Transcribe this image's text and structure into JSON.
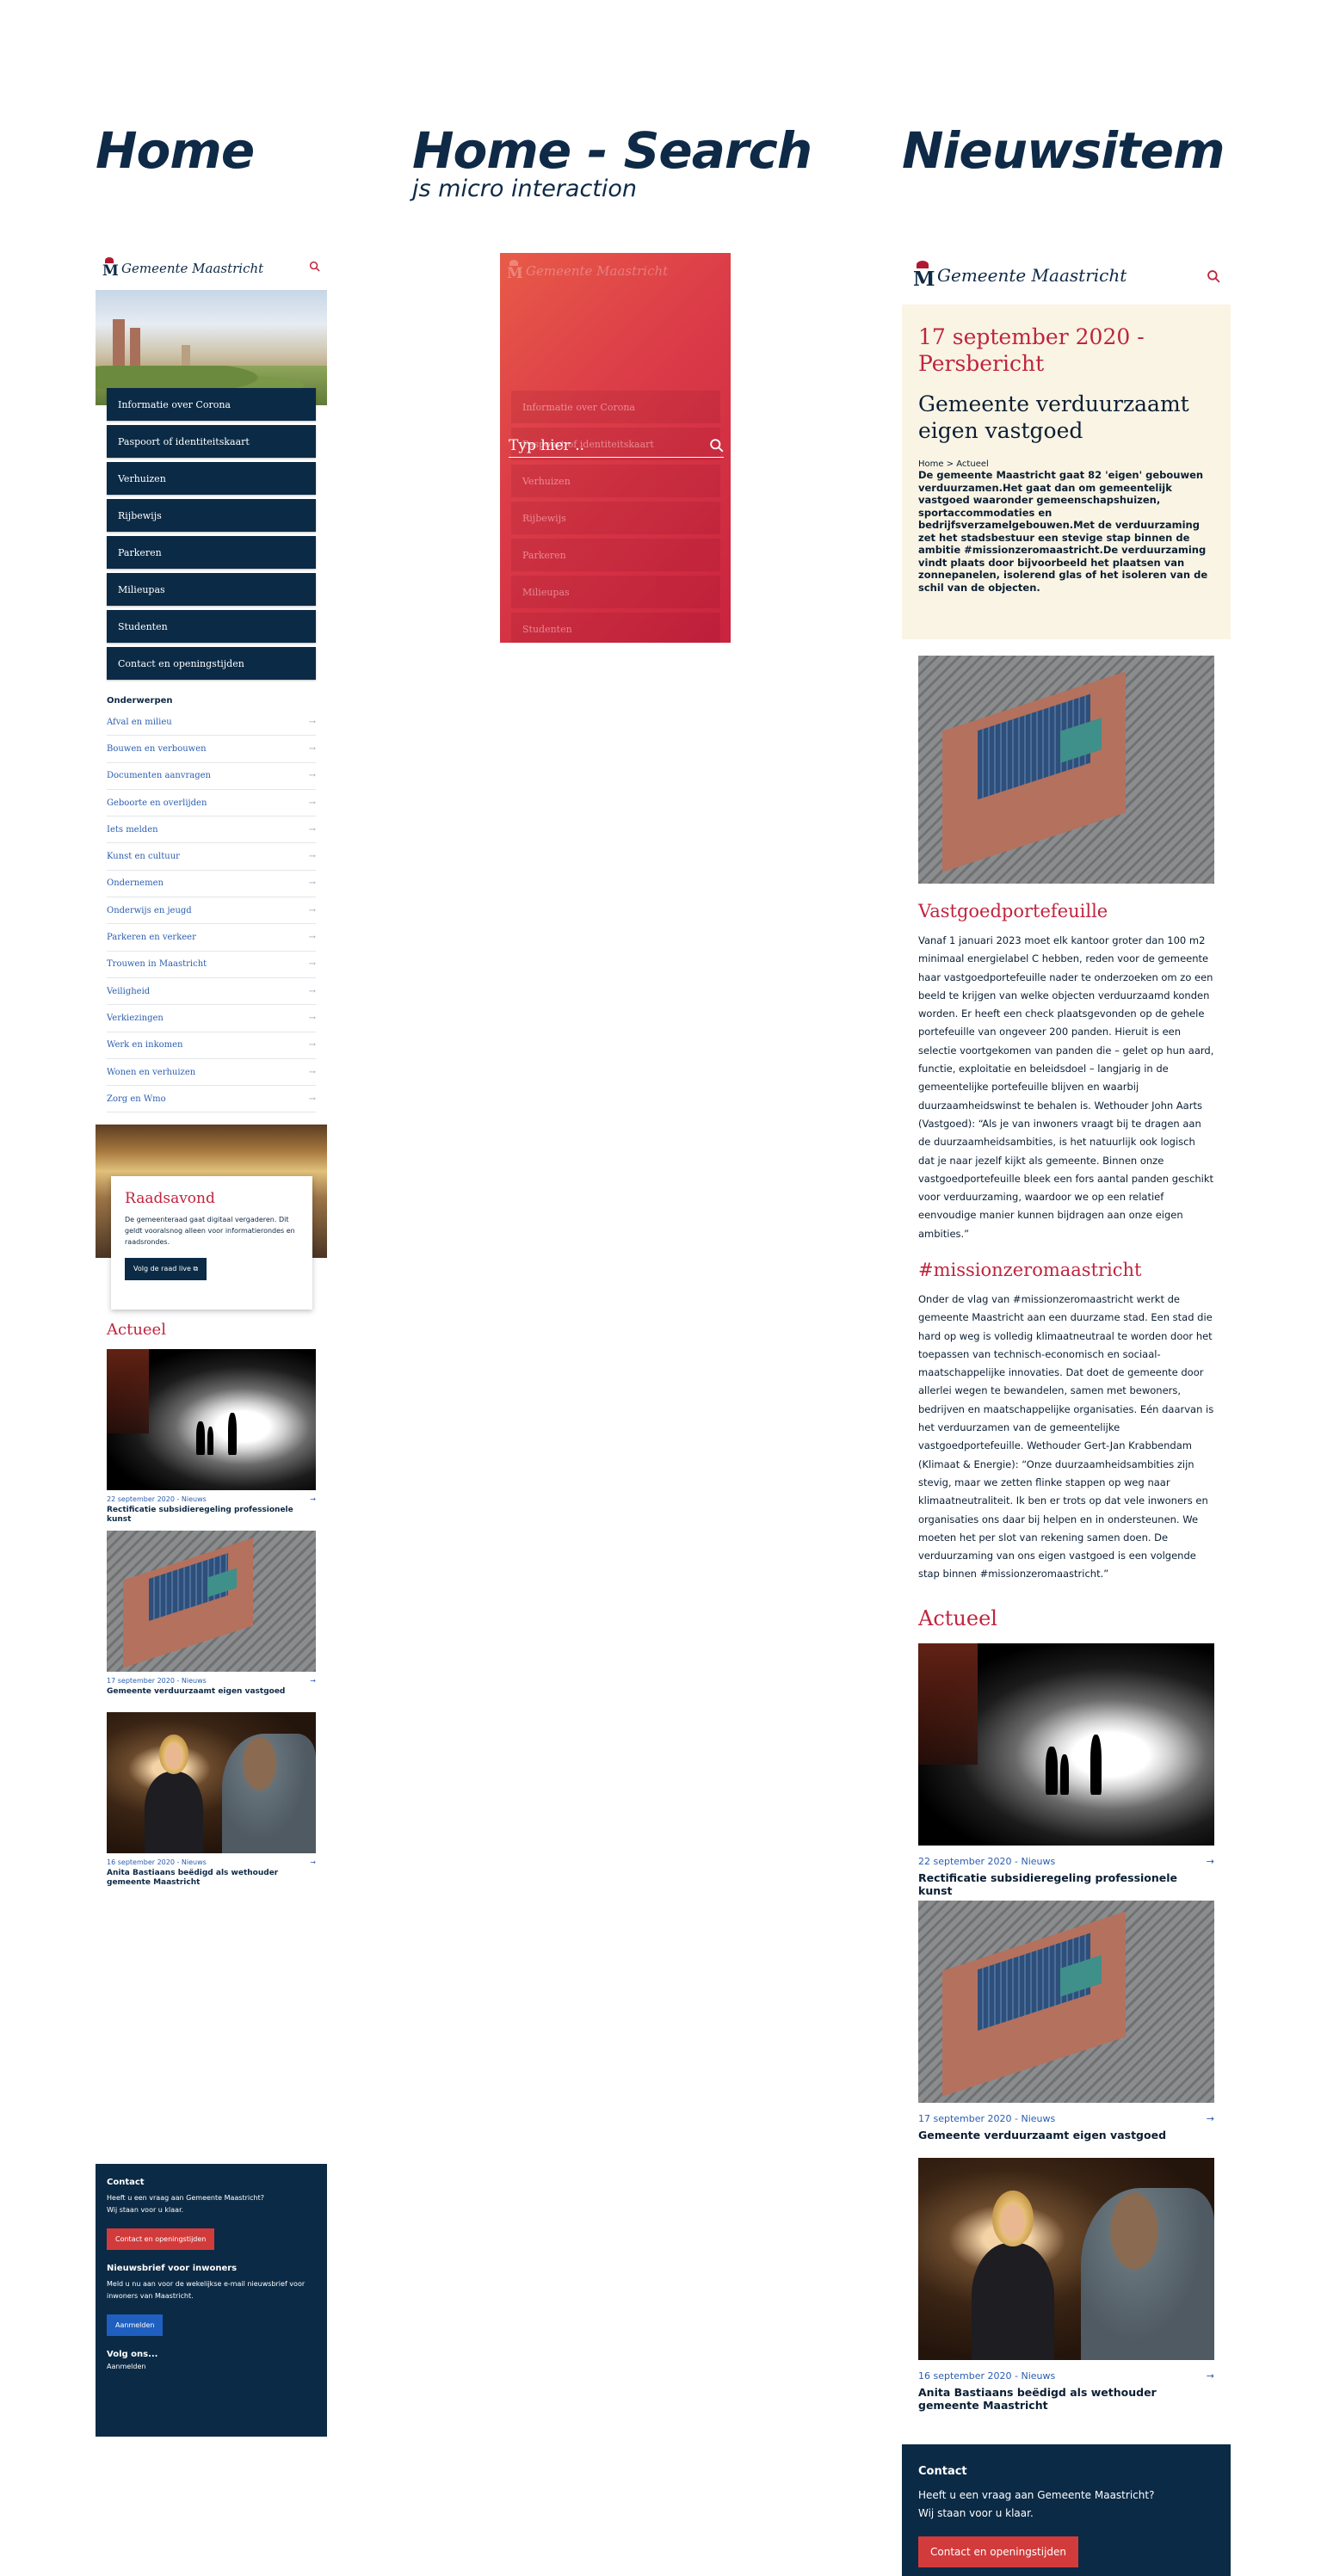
{
  "columns": {
    "home": "Home",
    "search": "Home - Search",
    "search_sub": "js micro interaction",
    "news": "Nieuwsitem"
  },
  "brand": {
    "name": "Gemeente Maastricht",
    "crest_letter": "M"
  },
  "colors": {
    "navy": "#0b2a45",
    "red": "#c0243e",
    "link": "#2a5db0",
    "cream": "#f9f4e4"
  },
  "menu": [
    "Informatie over Corona",
    "Paspoort of identiteitskaart",
    "Verhuizen",
    "Rijbewijs",
    "Parkeren",
    "Milieupas",
    "Studenten",
    "Contact en openingstijden"
  ],
  "topics": {
    "heading": "Onderwerpen",
    "items": [
      "Afval en milieu",
      "Bouwen en verbouwen",
      "Documenten aanvragen",
      "Geboorte en overlijden",
      "Iets melden",
      "Kunst en cultuur",
      "Ondernemen",
      "Onderwijs en jeugd",
      "Parkeren en verkeer",
      "Trouwen in Maastricht",
      "Veiligheid",
      "Verkiezingen",
      "Werk en inkomen",
      "Wonen en verhuizen",
      "Zorg en Wmo"
    ]
  },
  "raadsavond": {
    "title": "Raadsavond",
    "text": "De gemeenteraad gaat digitaal vergaderen. Dit geldt vooralsnog alleen voor informatierondes en raadsrondes.",
    "button": "Volg de raad live"
  },
  "actueel": {
    "heading": "Actueel",
    "items": [
      {
        "meta": "22 september 2020 - Nieuws",
        "title": "Rectificatie subsidieregeling professionele kunst"
      },
      {
        "meta": "17 september 2020 - Nieuws",
        "title": "Gemeente verduurzaamt eigen vastgoed"
      },
      {
        "meta": "16 september 2020 - Nieuws",
        "title": "Anita Bastiaans beëdigd als wethouder gemeente Maastricht"
      }
    ]
  },
  "footer": {
    "contact_heading": "Contact",
    "contact_text_1": "Heeft u een vraag aan Gemeente Maastricht?",
    "contact_text_2": "Wij staan voor u klaar.",
    "contact_button": "Contact en openingstijden",
    "newsletter_heading": "Nieuwsbrief voor inwoners",
    "newsletter_text": "Meld u nu aan voor de wekelijkse e-mail nieuwsbrief voor inwoners van Maastricht.",
    "newsletter_button": "Aanmelden",
    "follow_heading": "Volg ons...",
    "follow_link": "Aanmelden"
  },
  "search": {
    "placeholder": "Typ hier .."
  },
  "article": {
    "date": "17 september 2020 - Persbericht",
    "title": "Gemeente verduurzaamt eigen vastgoed",
    "breadcrumb": "Home > Actueel",
    "lead": "De gemeente Maastricht gaat 82 'eigen' gebouwen verduurzamen.Het gaat dan om gemeentelijk vastgoed waaronder gemeenschapshuizen, sportaccommodaties en bedrijfsverzamelgebouwen.Met de verduurzaming zet het stadsbestuur een stevige stap binnen de ambitie #missionzeromaastricht.De verduurzaming vindt plaats door bijvoorbeeld het plaatsen van zonnepanelen, isolerend glas of het isoleren van de schil van de objecten.",
    "section1_heading": "Vastgoedportefeuille",
    "section1_text": "Vanaf 1 januari 2023 moet elk kantoor groter dan 100 m2 minimaal energielabel C hebben, reden voor de gemeente haar vastgoedportefeuille nader te onderzoeken om zo een beeld te krijgen van welke objecten verduurzaamd konden worden. Er heeft een check plaatsgevonden op de gehele portefeuille van ongeveer 200 panden. Hieruit is een selectie voortgekomen van panden die – gelet op hun aard, functie, exploitatie en beleidsdoel – langjarig in de gemeentelijke portefeuille blijven en waarbij duurzaamheidswinst te behalen is. Wethouder John Aarts (Vastgoed): “Als je van inwoners vraagt bij te dragen aan de duurzaamheidsambities, is het natuurlijk ook logisch dat je naar jezelf kijkt als gemeente. Binnen onze vastgoedportefeuille bleek een fors aantal panden geschikt voor verduurzaming, waardoor we op een relatief eenvoudige manier kunnen bijdragen aan onze eigen ambities.”",
    "section2_heading": "#missionzeromaastricht",
    "section2_text": "Onder de vlag van #missionzeromaastricht werkt de gemeente Maastricht aan een duurzame stad. Een stad die hard op weg is volledig klimaatneutraal te worden door het toepassen van technisch-economisch en sociaal-maatschappelijke innovaties. Dat doet de gemeente door allerlei wegen te bewandelen, samen met bewoners, bedrijven en maatschappelijke organisaties. Eén daarvan is het verduurzamen van de gemeentelijke vastgoedportefeuille. Wethouder Gert-Jan Krabbendam (Klimaat & Energie): “Onze duurzaamheidsambities zijn stevig, maar we zetten flinke stappen op weg naar klimaatneutraliteit. Ik ben er trots op dat vele inwoners en organisaties ons daar bij helpen en in ondersteunen. We moeten het per slot van rekening samen doen. De verduurzaming van ons eigen vastgoed is een volgende stap binnen #missionzeromaastricht.”"
  }
}
